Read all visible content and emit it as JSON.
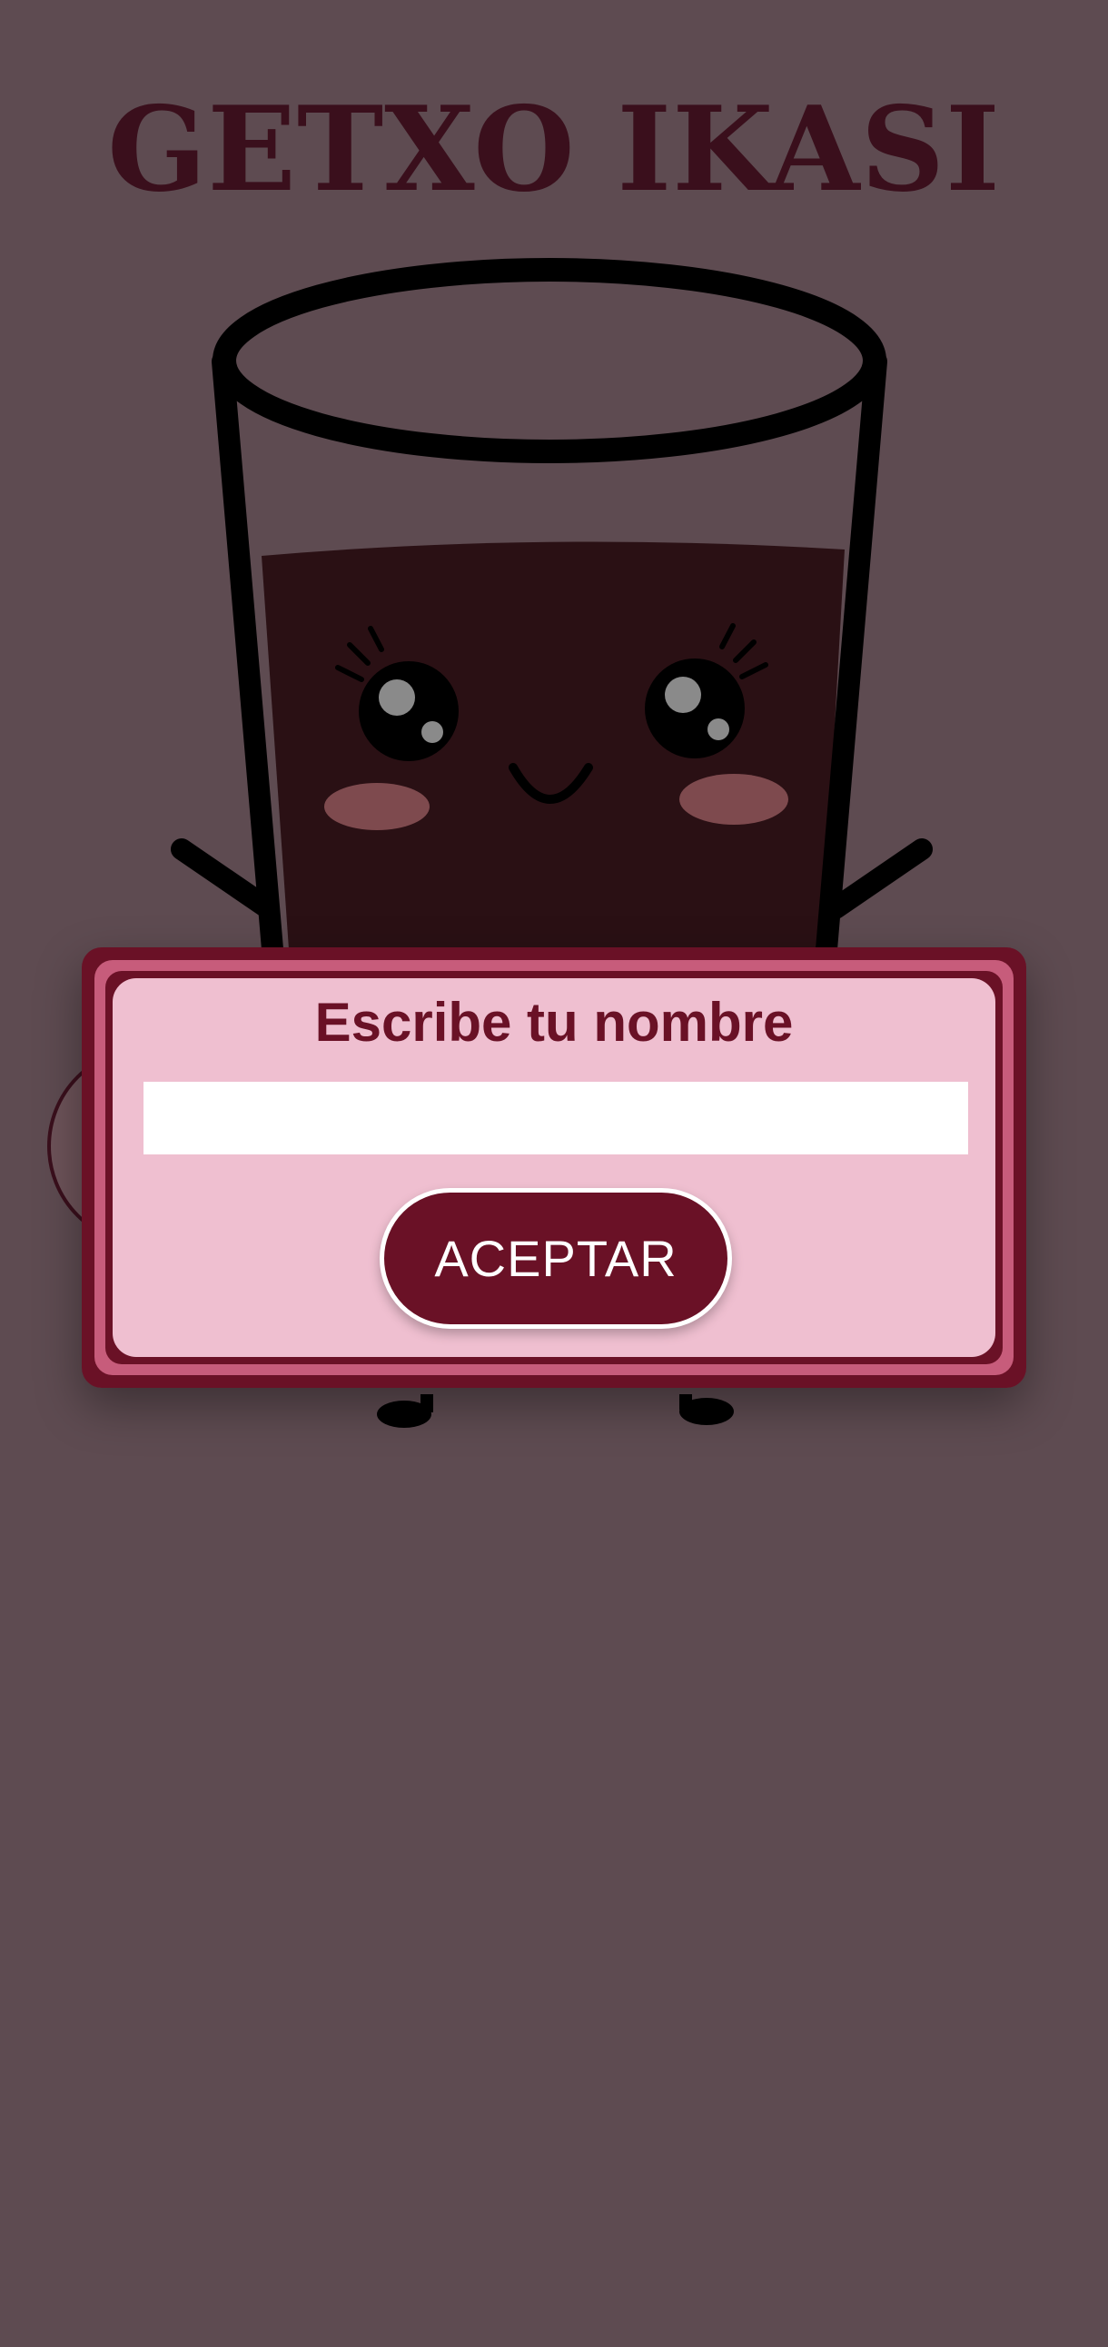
{
  "app": {
    "title": "GETXO IKASI"
  },
  "mascot": {
    "icon": "drink-glass-mascot-icon"
  },
  "dialog": {
    "title": "Escribe tu nombre",
    "name_input_value": "",
    "name_input_placeholder": "",
    "accept_label": "ACEPTAR"
  },
  "colors": {
    "background": "#5e4b51",
    "title": "#3a0f1c",
    "dialog_frame": "#6a1126",
    "dialog_band": "#c75c7b",
    "dialog_panel": "#efbfd0",
    "button": "#6a1126",
    "button_text": "#ffffff"
  }
}
